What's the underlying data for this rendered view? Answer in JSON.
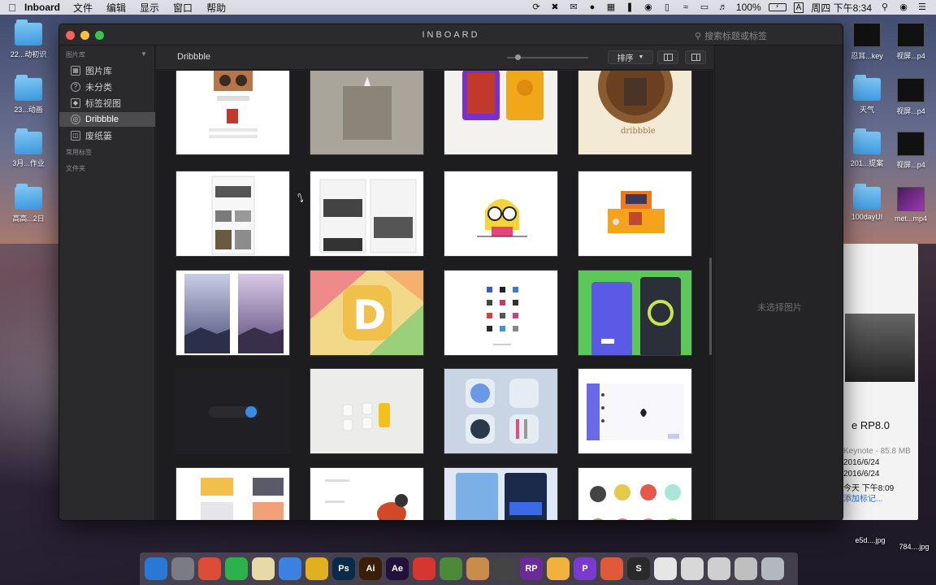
{
  "menubar": {
    "app_name": "Inboard",
    "menus": [
      "文件",
      "编辑",
      "显示",
      "窗口",
      "帮助"
    ],
    "battery": "100%",
    "clock": "周四 下午8:34",
    "input_source": "A"
  },
  "desktop": {
    "left_icons": [
      "22...动初识",
      "23...动画",
      "3月...作业",
      "高高...2日"
    ],
    "right_icons": [
      "忍耳...key",
      "视屏...p4",
      "天气",
      "视屏...p4",
      "201...提案",
      "视屏...p4",
      "100dayUI",
      "met...mp4"
    ],
    "bottom_labels": [
      "e5d....jpg",
      "784....jpg"
    ]
  },
  "back_window": {
    "title": "e RP8.0",
    "kind": "Keynote - 85.8 MB",
    "created": "2016/6/24",
    "modified": "2016/6/24",
    "opened": "今天 下午8:09",
    "tag_link": "添加标记..."
  },
  "window": {
    "title": "INBOARD",
    "search_placeholder": "搜索标题或标签"
  },
  "sidebar": {
    "library_header": "图片库",
    "items": [
      {
        "label": "图片库",
        "icon": "photo-library-icon"
      },
      {
        "label": "未分类",
        "icon": "question-icon"
      },
      {
        "label": "标签视图",
        "icon": "tag-icon"
      },
      {
        "label": "Dribbble",
        "icon": "dribbble-icon"
      },
      {
        "label": "废纸篓",
        "icon": "trash-icon"
      }
    ],
    "common_tags_header": "常用标签",
    "folders_header": "文件夹",
    "add_symbol": "+"
  },
  "toolbar": {
    "current_collection": "Dribbble",
    "sort_label": "排序"
  },
  "preview": {
    "empty_text": "未选择图片"
  },
  "dock": {
    "apps": [
      {
        "label": "",
        "color": "#2a78d6"
      },
      {
        "label": "",
        "color": "#7b7b85"
      },
      {
        "label": "",
        "color": "#dd4b39"
      },
      {
        "label": "",
        "color": "#2bb24c"
      },
      {
        "label": "",
        "color": "#e8d9a8"
      },
      {
        "label": "",
        "color": "#3b82e0"
      },
      {
        "label": "",
        "color": "#e0b020"
      },
      {
        "label": "Ps",
        "color": "#0a2a4a"
      },
      {
        "label": "Ai",
        "color": "#3a1f08"
      },
      {
        "label": "Ae",
        "color": "#22123a"
      },
      {
        "label": "",
        "color": "#d6362f"
      },
      {
        "label": "",
        "color": "#4c8a3a"
      },
      {
        "label": "",
        "color": "#c98c4a"
      },
      {
        "label": "",
        "color": "#444"
      },
      {
        "label": "RP",
        "color": "#6a2a9a"
      },
      {
        "label": "",
        "color": "#f2b23a"
      },
      {
        "label": "P",
        "color": "#7a3ad0"
      },
      {
        "label": "",
        "color": "#e05a3a"
      },
      {
        "label": "S",
        "color": "#2a2a2a"
      },
      {
        "label": "",
        "color": "#e6e6e6"
      },
      {
        "label": "",
        "color": "#d8d8d8"
      },
      {
        "label": "",
        "color": "#cfcfcf"
      },
      {
        "label": "",
        "color": "#bfbfbf"
      },
      {
        "label": "",
        "color": "#b0b8c0"
      }
    ]
  }
}
